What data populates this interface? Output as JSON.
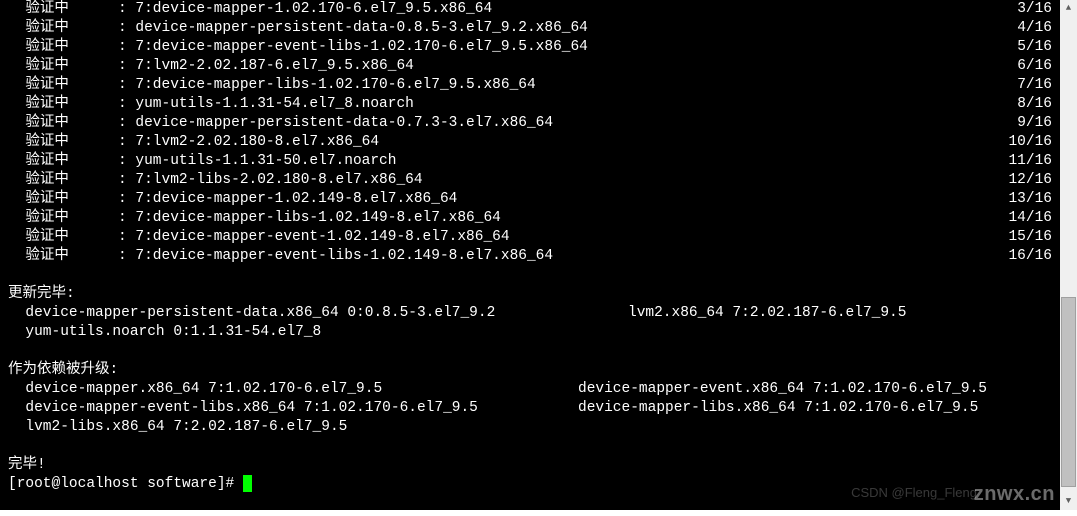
{
  "verify": {
    "label": "验证中",
    "colon": ": ",
    "lines": [
      {
        "pkg": "7:device-mapper-1.02.170-6.el7_9.5.x86_64",
        "count": "3/16"
      },
      {
        "pkg": "device-mapper-persistent-data-0.8.5-3.el7_9.2.x86_64",
        "count": "4/16"
      },
      {
        "pkg": "7:device-mapper-event-libs-1.02.170-6.el7_9.5.x86_64",
        "count": "5/16"
      },
      {
        "pkg": "7:lvm2-2.02.187-6.el7_9.5.x86_64",
        "count": "6/16"
      },
      {
        "pkg": "7:device-mapper-libs-1.02.170-6.el7_9.5.x86_64",
        "count": "7/16"
      },
      {
        "pkg": "yum-utils-1.1.31-54.el7_8.noarch",
        "count": "8/16"
      },
      {
        "pkg": "device-mapper-persistent-data-0.7.3-3.el7.x86_64",
        "count": "9/16"
      },
      {
        "pkg": "7:lvm2-2.02.180-8.el7.x86_64",
        "count": "10/16"
      },
      {
        "pkg": "yum-utils-1.1.31-50.el7.noarch",
        "count": "11/16"
      },
      {
        "pkg": "7:lvm2-libs-2.02.180-8.el7.x86_64",
        "count": "12/16"
      },
      {
        "pkg": "7:device-mapper-1.02.149-8.el7.x86_64",
        "count": "13/16"
      },
      {
        "pkg": "7:device-mapper-libs-1.02.149-8.el7.x86_64",
        "count": "14/16"
      },
      {
        "pkg": "7:device-mapper-event-1.02.149-8.el7.x86_64",
        "count": "15/16"
      },
      {
        "pkg": "7:device-mapper-event-libs-1.02.149-8.el7.x86_64",
        "count": "16/16"
      }
    ]
  },
  "updated": {
    "header": "更新完毕:",
    "rows": [
      {
        "col1": "  device-mapper-persistent-data.x86_64 0:0.8.5-3.el7_9.2",
        "col2": "lvm2.x86_64 7:2.02.187-6.el7_9.5"
      },
      {
        "col1": "  yum-utils.noarch 0:1.1.31-54.el7_8",
        "col2": ""
      }
    ]
  },
  "deps": {
    "header": "作为依赖被升级:",
    "rows": [
      {
        "col1": "  device-mapper.x86_64 7:1.02.170-6.el7_9.5",
        "col2": "device-mapper-event.x86_64 7:1.02.170-6.el7_9.5"
      },
      {
        "col1": "  device-mapper-event-libs.x86_64 7:1.02.170-6.el7_9.5",
        "col2": "device-mapper-libs.x86_64 7:1.02.170-6.el7_9.5"
      },
      {
        "col1": "  lvm2-libs.x86_64 7:2.02.187-6.el7_9.5",
        "col2": ""
      }
    ]
  },
  "done": "完毕!",
  "prompt": "[root@localhost software]# ",
  "watermark": "znwx.cn",
  "watermark_sub": "CSDN @Fleng_Fleng",
  "scrollbar": {
    "up": "▲",
    "down": "▼"
  }
}
